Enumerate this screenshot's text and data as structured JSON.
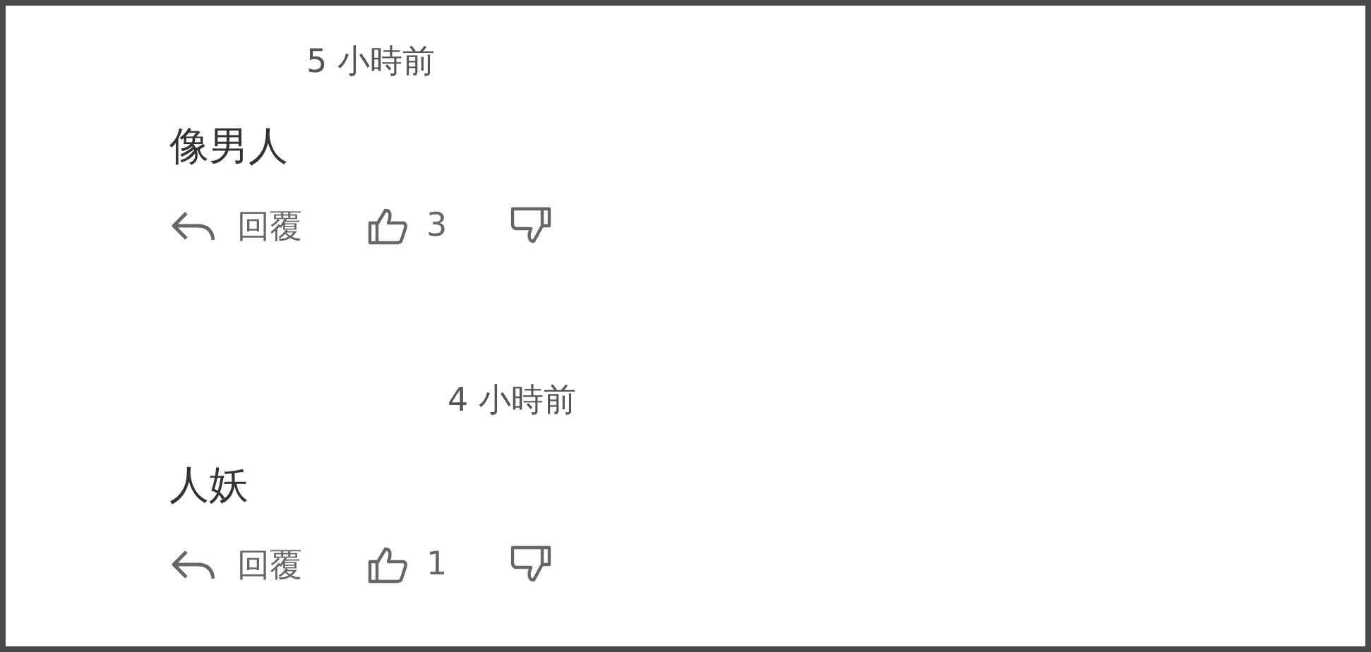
{
  "comments": [
    {
      "time": "5 小時前",
      "text": "像男人",
      "reply_label": "回覆",
      "likes": "3"
    },
    {
      "time": "4 小時前",
      "text": "人妖",
      "reply_label": "回覆",
      "likes": "1"
    }
  ]
}
